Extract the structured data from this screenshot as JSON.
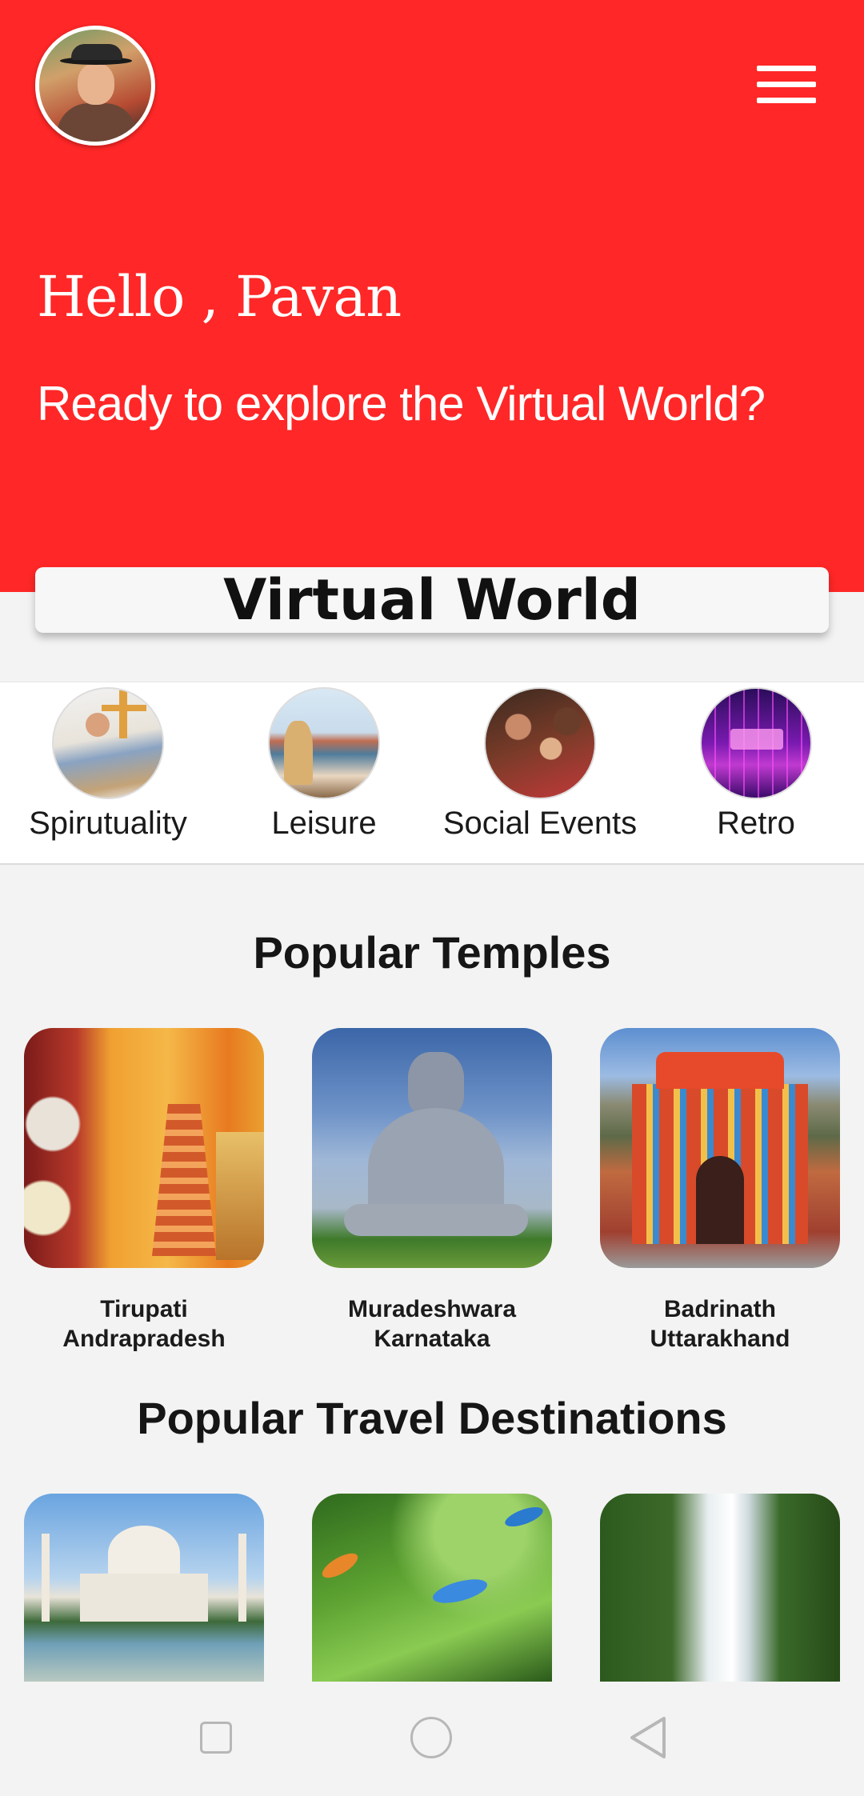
{
  "header": {
    "greeting": "Hello , Pavan",
    "tagline": "Ready to explore the Virtual World?",
    "accent_color": "#ff2727"
  },
  "banner": {
    "title": "Virtual World"
  },
  "categories": [
    {
      "label": "Spirutuality",
      "icon": "person-relaxing-image"
    },
    {
      "label": "Leisure",
      "icon": "woman-boat-image"
    },
    {
      "label": "Social Events",
      "icon": "party-group-image"
    },
    {
      "label": "Retro",
      "icon": "retro-neon-image"
    }
  ],
  "temples": {
    "title": "Popular Temples",
    "items": [
      {
        "name": "Tirupati",
        "region": "Andrapradesh"
      },
      {
        "name": "Muradeshwara",
        "region": "Karnataka"
      },
      {
        "name": "Badrinath",
        "region": "Uttarakhand"
      }
    ]
  },
  "destinations": {
    "title": "Popular Travel Destinations",
    "items": [
      {
        "image": "taj-mahal-image"
      },
      {
        "image": "kingfisher-birds-image"
      },
      {
        "image": "waterfall-image"
      }
    ]
  },
  "system_nav": {
    "icons": [
      "recent-apps-icon",
      "home-icon",
      "back-icon"
    ]
  }
}
